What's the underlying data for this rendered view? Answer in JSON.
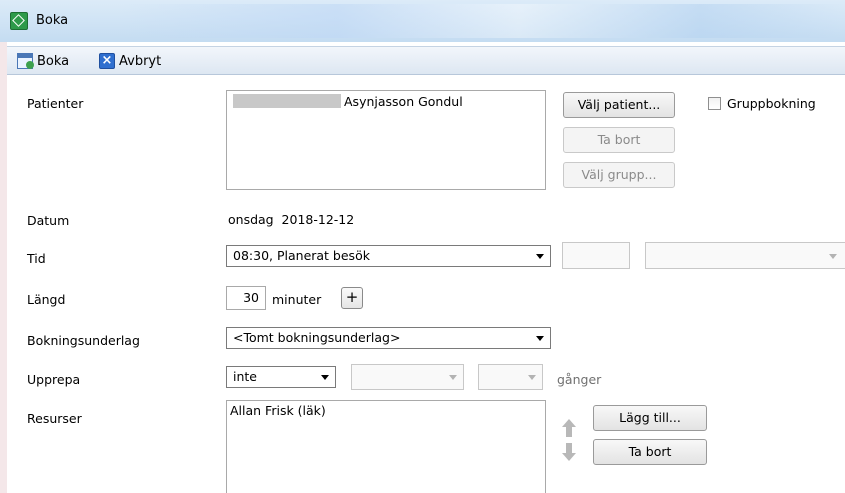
{
  "window": {
    "title": "Boka",
    "icon": "booking-app-icon"
  },
  "toolbar": {
    "boka_label": "Boka",
    "boka_icon": "calendar-add-icon",
    "avbryt_label": "Avbryt",
    "avbryt_icon": "close-icon"
  },
  "form": {
    "patienter": {
      "label": "Patienter",
      "patient_name": "Asynjasson Gondul",
      "choose_patient_button": "Välj patient...",
      "remove_button": "Ta bort",
      "choose_group_button": "Välj grupp...",
      "group_booking_label": "Gruppbokning",
      "group_booking_checked": false
    },
    "datum": {
      "label": "Datum",
      "value": "onsdag  2018-12-12"
    },
    "tid": {
      "label": "Tid",
      "value": "08:30, Planerat besök"
    },
    "langd": {
      "label": "Längd",
      "value": "30",
      "unit": "minuter",
      "plus": "+"
    },
    "bokningsunderlag": {
      "label": "Bokningsunderlag",
      "value": "<Tomt bokningsunderlag>"
    },
    "upprepa": {
      "label": "Upprepa",
      "value": "inte",
      "times_label": "gånger"
    },
    "resurser": {
      "label": "Resurser",
      "value": "Allan Frisk (läk)",
      "add_button": "Lägg till...",
      "remove_button": "Ta bort"
    }
  },
  "colors": {
    "titlebar": "#cfe3f5",
    "toolbar": "#dde7f2",
    "left_strip": "#f4e7e9"
  }
}
